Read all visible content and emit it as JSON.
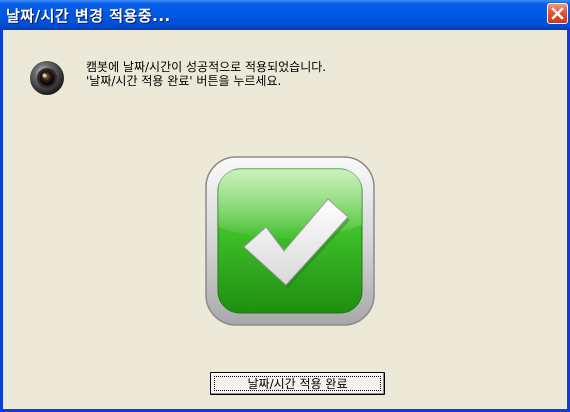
{
  "window": {
    "title": "날짜/시간 변경 적용중..."
  },
  "message": {
    "line1": "캠봇에 날짜/시간이 성공적으로 적용되었습니다.",
    "line2": "'날짜/시간 적용 완료' 버튼을 누르세요."
  },
  "icons": {
    "camera": "webcam-icon",
    "success": "checkmark-icon",
    "close": "close-icon"
  },
  "button": {
    "label": "날짜/시간 적용 완료"
  },
  "colors": {
    "titlebar": "#0058E6",
    "background": "#ECE9D8",
    "check_green": "#3DBE28",
    "close_red": "#E5573A"
  }
}
